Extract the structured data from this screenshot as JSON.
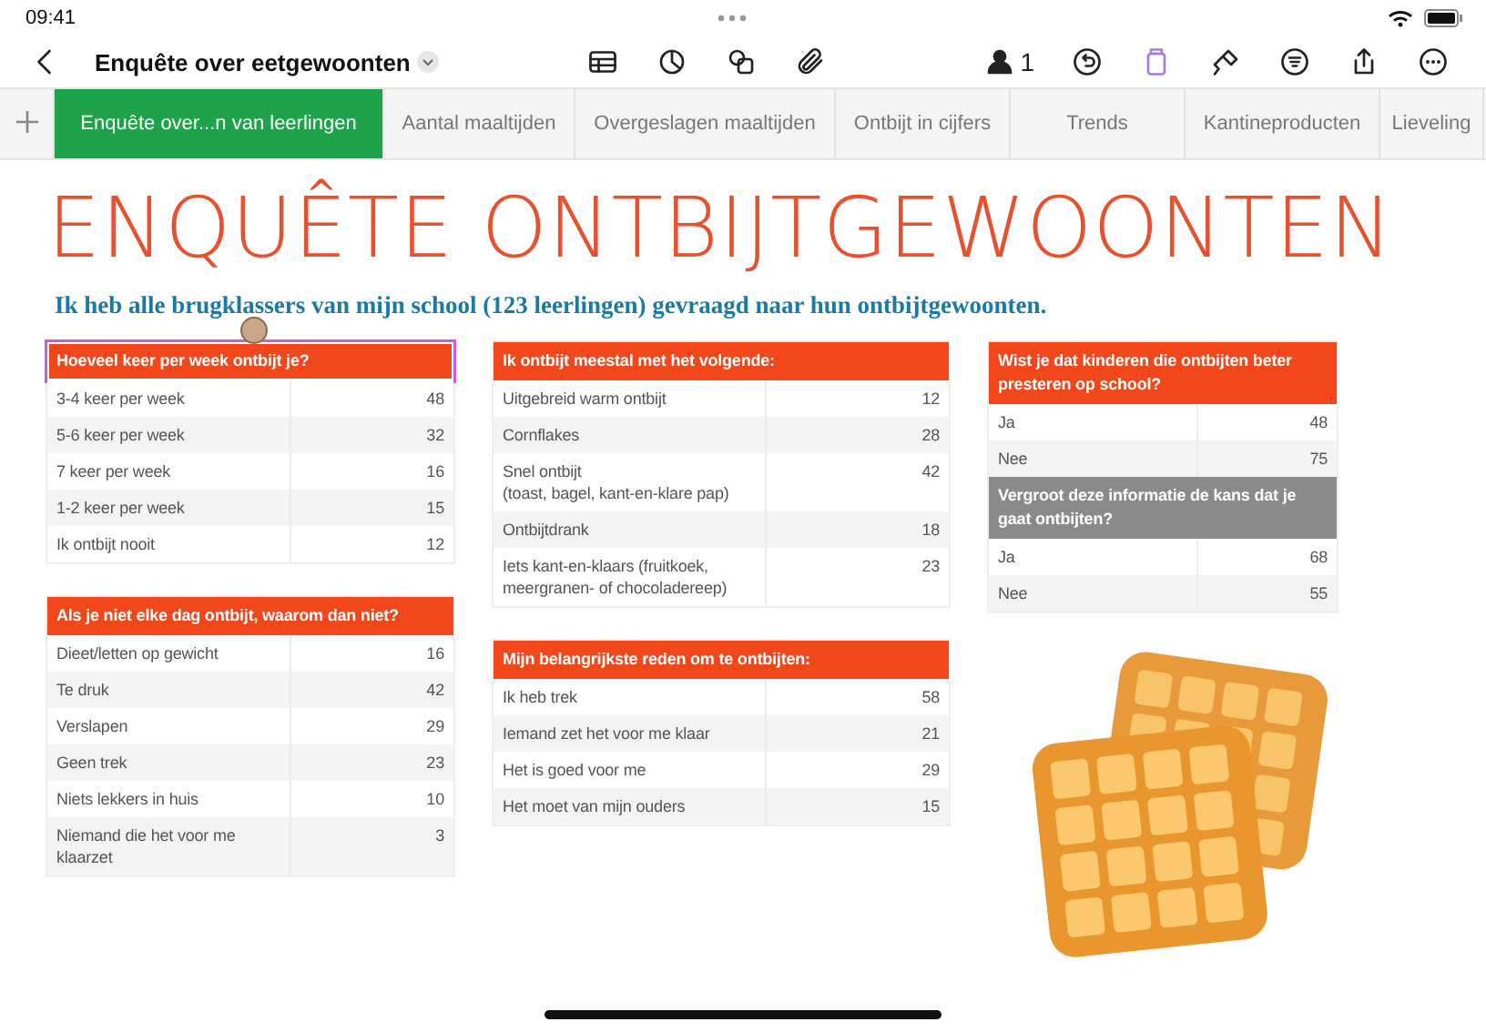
{
  "status_bar": {
    "time": "09:41"
  },
  "toolbar": {
    "title": "Enquête over eetgewoonten",
    "collaborator_count": "1"
  },
  "tabs": [
    {
      "label": "Enquête over...n van leerlingen",
      "selected": true
    },
    {
      "label": "Aantal maaltijden",
      "selected": false
    },
    {
      "label": "Overgeslagen maaltijden",
      "selected": false
    },
    {
      "label": "Ontbijt in cijfers",
      "selected": false
    },
    {
      "label": "Trends",
      "selected": false
    },
    {
      "label": "Kantineproducten",
      "selected": false
    },
    {
      "label": "Lieveling",
      "selected": false
    }
  ],
  "page": {
    "title": "ENQUÊTE ONTBIJTGEWOONTEN",
    "subtitle": "Ik heb alle brugklassers van mijn school (123 leerlingen) gevraagd naar hun ontbijtgewoonten.",
    "columns": [
      [
        {
          "selected": true,
          "sections": [
            {
              "kind": "primary",
              "title": "Hoeveel keer per week ontbijt je?",
              "rows": [
                {
                  "label": "3-4 keer per week",
                  "value": "48"
                },
                {
                  "label": "5-6 keer per week",
                  "value": "32"
                },
                {
                  "label": "7 keer per week",
                  "value": "16"
                },
                {
                  "label": "1-2 keer per week",
                  "value": "15"
                },
                {
                  "label": "Ik ontbijt nooit",
                  "value": "12"
                }
              ]
            }
          ]
        },
        {
          "selected": false,
          "sections": [
            {
              "kind": "primary",
              "title": "Als je niet elke dag ontbijt, waarom dan niet?",
              "rows": [
                {
                  "label": "Dieet/letten op gewicht",
                  "value": "16"
                },
                {
                  "label": "Te druk",
                  "value": "42"
                },
                {
                  "label": "Verslapen",
                  "value": "29"
                },
                {
                  "label": "Geen trek",
                  "value": "23"
                },
                {
                  "label": "Niets lekkers in huis",
                  "value": "10"
                },
                {
                  "label": "Niemand die het voor me klaarzet",
                  "value": "3"
                }
              ]
            }
          ]
        }
      ],
      [
        {
          "selected": false,
          "sections": [
            {
              "kind": "primary",
              "title": "Ik ontbijt meestal met het volgende:",
              "rows": [
                {
                  "label": "Uitgebreid warm ontbijt",
                  "value": "12"
                },
                {
                  "label": "Cornflakes",
                  "value": "28"
                },
                {
                  "label": "Snel ontbijt\n(toast, bagel, kant-en-klare pap)",
                  "value": "42"
                },
                {
                  "label": "Ontbijtdrank",
                  "value": "18"
                },
                {
                  "label": "Iets kant-en-klaars (fruitkoek,\nmeergranen- of chocoladereep)",
                  "value": "23"
                }
              ]
            }
          ]
        },
        {
          "selected": false,
          "sections": [
            {
              "kind": "primary",
              "title": "Mijn belangrijkste reden om te ontbijten:",
              "rows": [
                {
                  "label": "Ik heb trek",
                  "value": "58"
                },
                {
                  "label": "Iemand zet het voor me klaar",
                  "value": "21"
                },
                {
                  "label": "Het is goed voor me",
                  "value": "29"
                },
                {
                  "label": "Het moet van mijn ouders",
                  "value": "15"
                }
              ]
            }
          ]
        }
      ],
      [
        {
          "selected": false,
          "sections": [
            {
              "kind": "primary",
              "title": "Wist je dat kinderen die ontbijten beter presteren op school?",
              "rows": [
                {
                  "label": "Ja",
                  "value": "48"
                },
                {
                  "label": "Nee",
                  "value": "75"
                }
              ]
            },
            {
              "kind": "secondary",
              "title": "Vergroot deze informatie de kans dat je gaat ontbijten?",
              "rows": [
                {
                  "label": "Ja",
                  "value": "68"
                },
                {
                  "label": "Nee",
                  "value": "55"
                }
              ]
            }
          ]
        }
      ]
    ]
  }
}
